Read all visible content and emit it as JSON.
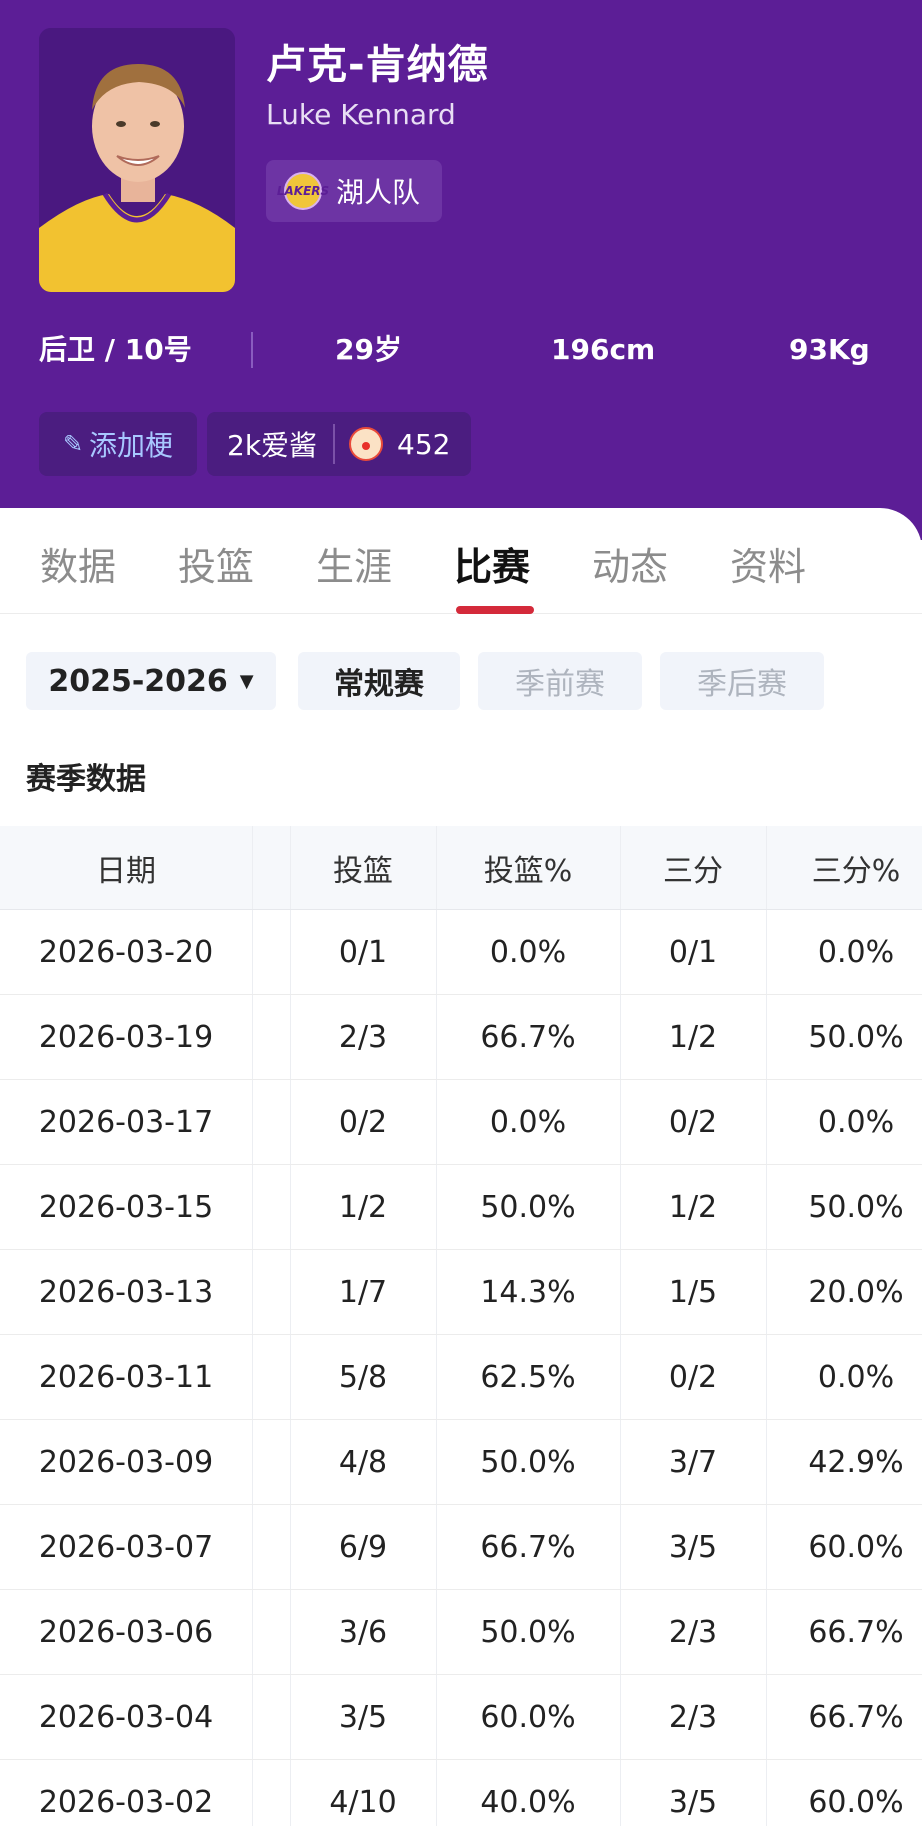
{
  "player": {
    "name_cn": "卢克-肯纳德",
    "name_en": "Luke Kennard",
    "team": {
      "name": "湖人队",
      "logo_icon": "lakers-logo-icon",
      "logo_text": "LAKERS"
    },
    "position": "后卫 / 10号",
    "age": "29岁",
    "height": "196cm",
    "weight": "93Kg"
  },
  "tags": {
    "add_meme": "添加梗",
    "fan_label": "2k爱酱",
    "fan_count": "452"
  },
  "tabs": [
    {
      "label": "数据"
    },
    {
      "label": "投篮"
    },
    {
      "label": "生涯"
    },
    {
      "label": "比赛",
      "active": true
    },
    {
      "label": "动态"
    },
    {
      "label": "资料"
    }
  ],
  "filters": {
    "season": "2025-2026",
    "regular": "常规赛",
    "preseason": "季前赛",
    "playoffs": "季后赛"
  },
  "section_title": "赛季数据",
  "table": {
    "headers": [
      "日期",
      "投篮",
      "投篮%",
      "三分",
      "三分%"
    ],
    "rows": [
      [
        "2026-03-20",
        "0/1",
        "0.0%",
        "0/1",
        "0.0%"
      ],
      [
        "2026-03-19",
        "2/3",
        "66.7%",
        "1/2",
        "50.0%"
      ],
      [
        "2026-03-17",
        "0/2",
        "0.0%",
        "0/2",
        "0.0%"
      ],
      [
        "2026-03-15",
        "1/2",
        "50.0%",
        "1/2",
        "50.0%"
      ],
      [
        "2026-03-13",
        "1/7",
        "14.3%",
        "1/5",
        "20.0%"
      ],
      [
        "2026-03-11",
        "5/8",
        "62.5%",
        "0/2",
        "0.0%"
      ],
      [
        "2026-03-09",
        "4/8",
        "50.0%",
        "3/7",
        "42.9%"
      ],
      [
        "2026-03-07",
        "6/9",
        "66.7%",
        "3/5",
        "60.0%"
      ],
      [
        "2026-03-06",
        "3/6",
        "50.0%",
        "2/3",
        "66.7%"
      ],
      [
        "2026-03-04",
        "3/5",
        "60.0%",
        "2/3",
        "66.7%"
      ],
      [
        "2026-03-02",
        "4/10",
        "40.0%",
        "3/5",
        "60.0%"
      ]
    ]
  },
  "colors": {
    "header_bg": "#5c1e96",
    "tab_active_underline": "#d42a3a",
    "add_meme_text": "#a8c8ff"
  }
}
